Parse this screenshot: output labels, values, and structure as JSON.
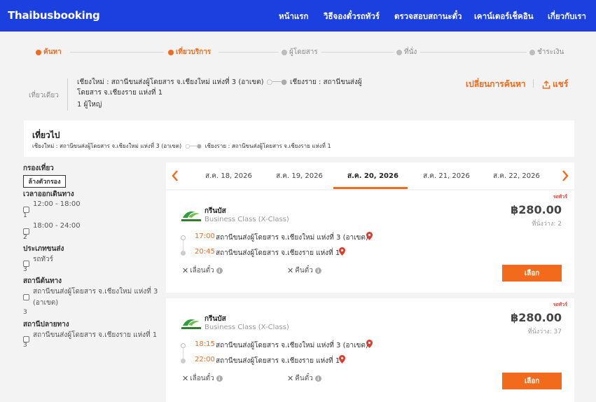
{
  "header": {
    "logo": "Thaibusbooking",
    "nav": [
      "หน้าแรก",
      "วิธีจองตั๋วรถทัวร์",
      "ตรวจสอบสถานะตั๋ว",
      "เคาน์เตอร์เช็คอิน",
      "เกี่ยวกับเรา"
    ]
  },
  "stepper": [
    "ค้นหา",
    "เที่ยวบริการ",
    "ผู้โดยสาร",
    "ที่นั่ง",
    "ชำระเงิน"
  ],
  "summary": {
    "trip_type": "เที่ยวเดียว",
    "origin": "เชียงใหม่ : สถานีขนส่งผู้โดยสาร จ.เชียงใหม่ แห่งที่ 3 (อาเขต)",
    "destination_prefix": "เชียงราย : สถานีขนส่งผู้",
    "destination_rest": "โดยสาร จ.เชียงราย แห่งที่ 1",
    "passengers": "1 ผู้ใหญ่",
    "change_search": "เปลี่ยนการค้นหา",
    "share": "แชร์"
  },
  "outbound": {
    "title": "เที่ยวไป",
    "origin": "เชียงใหม่ : สถานีขนส่งผู้โดยสาร จ.เชียงใหม่ แห่งที่ 3 (อาเขต)",
    "destination": "เชียงราย : สถานีขนส่งผู้โดยสาร จ.เชียงราย แห่งที่ 1"
  },
  "filters": {
    "title": "กรองเที่ยว",
    "clear": "ล้างตัวกรอง",
    "departure_title": "เวลาออกเดินทาง",
    "departure_opts": [
      {
        "label": "12:00 - 18:00",
        "count": "1"
      },
      {
        "label": "18:00 - 24:00",
        "count": "2"
      }
    ],
    "vehicle_title": "ประเภทขนส่ง",
    "vehicle_opt": {
      "label": "รถทัวร์",
      "count": "3"
    },
    "origin_title": "สถานีต้นทาง",
    "origin_opt": {
      "label1": "สถานีขนส่งผู้โดยสาร จ.เชียงใหม่ แห่งที่ 3",
      "label2": "(อาเขต)",
      "count": "3"
    },
    "dest_title": "สถานีปลายทาง",
    "dest_opt": {
      "label": "สถานีขนส่งผู้โดยสาร จ.เชียงราย แห่งที่ 1",
      "count": "3"
    }
  },
  "dates": [
    "ส.ค. 18, 2026",
    "ส.ค. 19, 2026",
    "ส.ค. 20, 2026",
    "ส.ค. 21, 2026",
    "ส.ค. 22, 2026"
  ],
  "trips": [
    {
      "tag": "รถทัวร์",
      "operator": "กรีนบัส",
      "class": "Business Class (X-Class)",
      "price": "฿280.00",
      "seats": "ที่นั่งว่าง: 2",
      "dep_time": "17:00",
      "dep_station": "สถานีขนส่งผู้โดยสาร จ.เชียงใหม่ แห่งที่ 3 (อาเขต)",
      "arr_time": "20:45",
      "arr_station": "สถานีขนส่งผู้โดยสาร จ.เชียงราย แห่งที่ 1",
      "postpone": "เลื่อนตั๋ว",
      "refund": "คืนตั๋ว",
      "select": "เลือก"
    },
    {
      "tag": "รถทัวร์",
      "operator": "กรีนบัส",
      "class": "Business Class (X-Class)",
      "price": "฿280.00",
      "seats": "ที่นั่งว่าง: 37",
      "dep_time": "18:15",
      "dep_station": "สถานีขนส่งผู้โดยสาร จ.เชียงใหม่ แห่งที่ 3 (อาเขต)",
      "arr_time": "22:00",
      "arr_station": "สถานีขนส่งผู้โดยสาร จ.เชียงราย แห่งที่ 1",
      "postpone": "เลื่อนตั๋ว",
      "refund": "คืนตั๋ว",
      "select": "เลือก"
    }
  ],
  "colors": {
    "header": "#1c3fe0",
    "accent": "#f26a1b",
    "tag": "#e23b2b"
  }
}
